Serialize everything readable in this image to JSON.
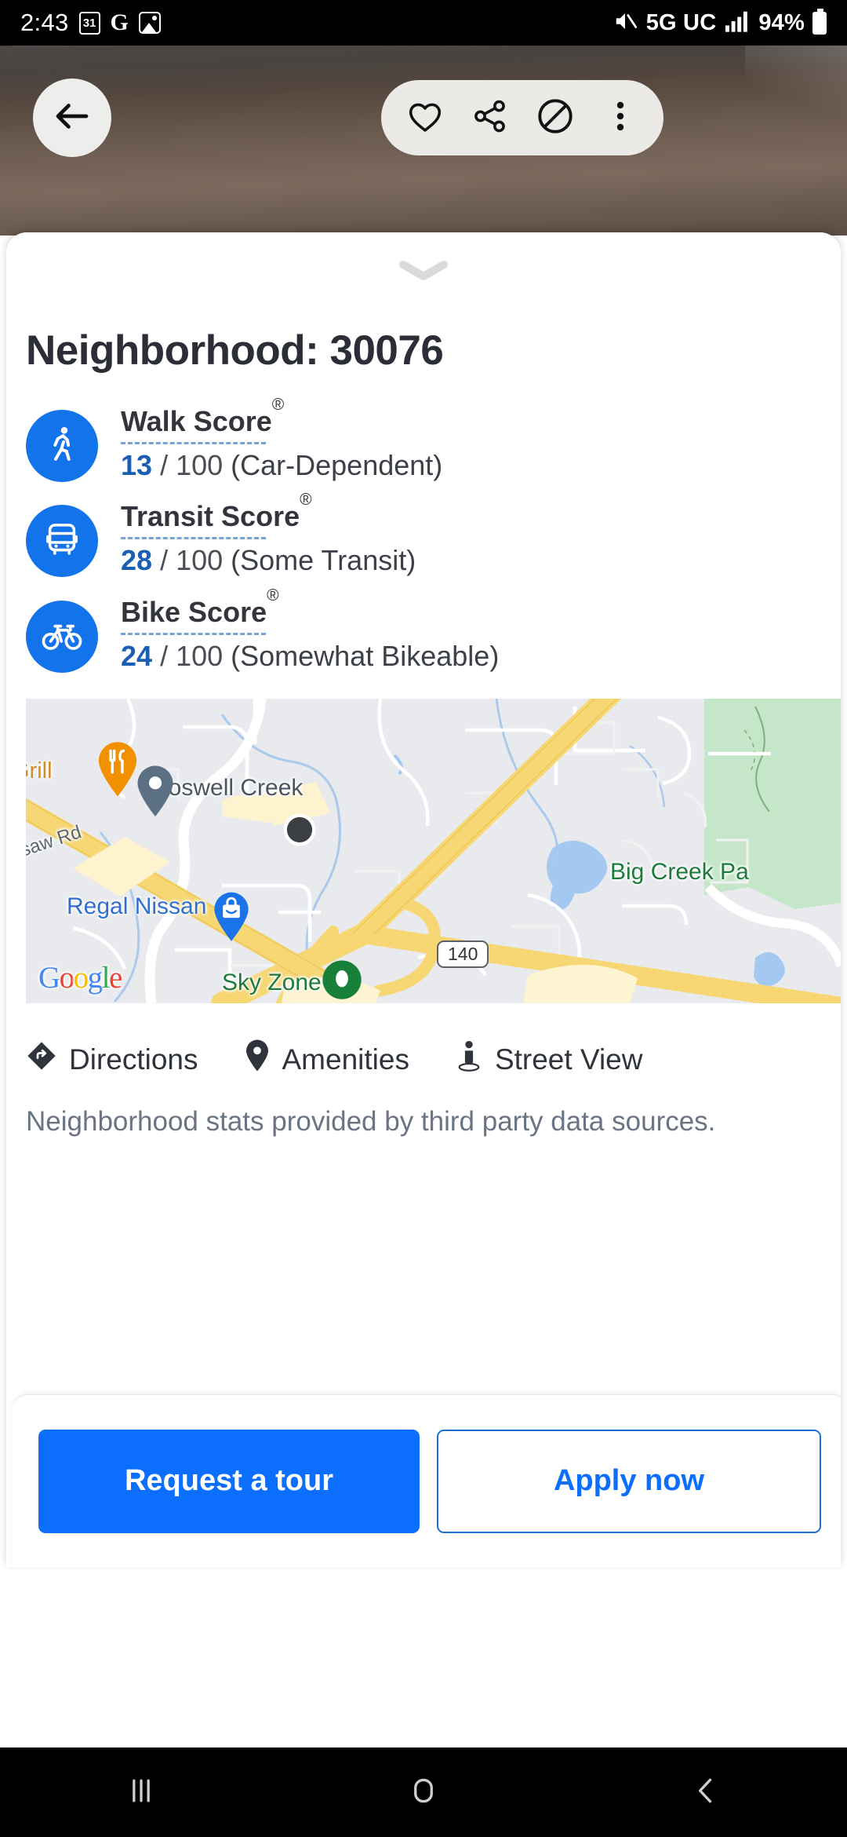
{
  "status_bar": {
    "time": "2:43",
    "calendar_day": "31",
    "google_label": "G",
    "network": "5G UC",
    "battery_percent": "94%",
    "icons": [
      "calendar-icon",
      "google-icon",
      "photos-icon",
      "mute-icon",
      "signal-icon",
      "battery-icon"
    ]
  },
  "hero": {
    "back_icon": "back-arrow-icon",
    "actions": [
      "heart-icon",
      "share-icon",
      "hide-icon",
      "more-options-icon"
    ]
  },
  "sheet": {
    "drag_handle_icon": "chevron-down-icon",
    "title": "Neighborhood: 30076"
  },
  "scores": [
    {
      "id": "walk",
      "icon": "walking-person-icon",
      "name": "Walk Score",
      "registered": "®",
      "value": "13",
      "separator": "/ 100",
      "description": "(Car-Dependent)"
    },
    {
      "id": "transit",
      "icon": "bus-icon",
      "name": "Transit Score",
      "registered": "®",
      "value": "28",
      "separator": "/ 100",
      "description": "(Some Transit)"
    },
    {
      "id": "bike",
      "icon": "bicycle-icon",
      "name": "Bike Score",
      "registered": "®",
      "value": "24",
      "separator": "/ 100",
      "description": "(Somewhat Bikeable)"
    }
  ],
  "map": {
    "provider": "Google",
    "labels": {
      "grill": "Grill",
      "roswell_creek": "Roswell Creek",
      "saw_rd": "saw Rd",
      "regal_nissan": "Regal Nissan",
      "big_creek_park": "Big Creek Pa",
      "sky_zone": "Sky Zone",
      "route_shield": "140"
    },
    "pins": [
      {
        "name": "restaurant-pin",
        "color": "#F29100",
        "label": "Grill"
      },
      {
        "name": "place-pin",
        "color": "#5B7083",
        "label": "Roswell Creek"
      },
      {
        "name": "property-marker",
        "color": "#3C4043",
        "label": ""
      },
      {
        "name": "shopping-pin",
        "color": "#1A73E8",
        "label": "Regal Nissan"
      },
      {
        "name": "recreation-pin",
        "color": "#188038",
        "label": "Sky Zone"
      }
    ],
    "actions": [
      {
        "id": "directions",
        "icon": "directions-icon",
        "label": "Directions"
      },
      {
        "id": "amenities",
        "icon": "map-pin-icon",
        "label": "Amenities"
      },
      {
        "id": "street-view",
        "icon": "pegman-icon",
        "label": "Street View"
      }
    ]
  },
  "disclaimer": "Neighborhood stats provided by third party data sources.",
  "cta": {
    "request_tour": "Request a tour",
    "apply_now": "Apply now"
  },
  "nav_bar": {
    "recents_icon": "recents-icon",
    "home_icon": "home-icon",
    "back_icon": "nav-back-icon"
  },
  "colors": {
    "accent_blue": "#0b6efd",
    "badge_blue": "#1273eb",
    "score_value_blue": "#1a5fb4",
    "title_dark": "#2b2e36",
    "disclaimer_gray": "#6a7483"
  }
}
